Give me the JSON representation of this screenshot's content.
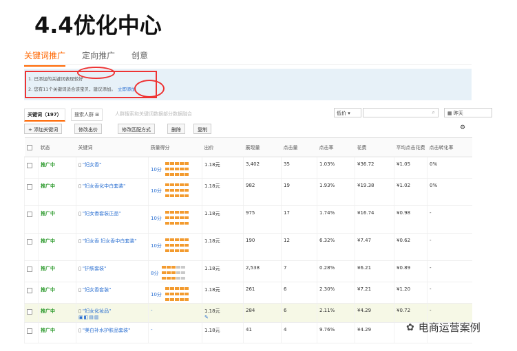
{
  "slide_title": "4.4优化中心",
  "tabs": [
    "关键词推广",
    "定向推广",
    "创意"
  ],
  "notice": {
    "line1": "1. 已添加的关键词表现较好",
    "line2": "2. 您有11个关键词适合该宝贝，建议添加。",
    "link": "立即添加"
  },
  "subbar": {
    "tab_keywords": "关键词（197）",
    "tab_people": "搜索人群",
    "hint": "人群搜索和关键词数据部分数据融合",
    "select": "低价",
    "date": "昨天"
  },
  "toolbar": {
    "add": "+ 添加关键词",
    "bid": "修改出价",
    "match": "修改匹配方式",
    "delete": "删除",
    "copy": "复制",
    "settings_icon": "gear-icon"
  },
  "columns": [
    "状态",
    "关键词",
    "质量得分",
    "出价",
    "展现量",
    "点击量",
    "点击率",
    "花费",
    "平均点击花费",
    "点击转化率"
  ],
  "rows": [
    {
      "status": "推广中",
      "keyword": "\"妇女香\"",
      "score": "10分",
      "bid": "1.18元",
      "impr": "3,402",
      "clicks": "35",
      "ctr": "1.03%",
      "cost": "¥36.72",
      "cpc": "¥1.05",
      "cvr": "0%"
    },
    {
      "status": "推广中",
      "keyword": "\"妇女香化中白套装\"",
      "score": "10分",
      "bid": "1.18元",
      "impr": "982",
      "clicks": "19",
      "ctr": "1.93%",
      "cost": "¥19.38",
      "cpc": "¥1.02",
      "cvr": "0%"
    },
    {
      "status": "推广中",
      "keyword": "\"妇女香套装正品\"",
      "score": "10分",
      "bid": "1.18元",
      "impr": "975",
      "clicks": "17",
      "ctr": "1.74%",
      "cost": "¥16.74",
      "cpc": "¥0.98",
      "cvr": "-"
    },
    {
      "status": "推广中",
      "keyword": "\"妇女香 妇女香中白套装\"",
      "score": "10分",
      "bid": "1.18元",
      "impr": "190",
      "clicks": "12",
      "ctr": "6.32%",
      "cost": "¥7.47",
      "cpc": "¥0.62",
      "cvr": "-"
    },
    {
      "status": "推广中",
      "keyword": "\"护肤套装\"",
      "score": "8分",
      "bid": "1.18元",
      "impr": "2,538",
      "clicks": "7",
      "ctr": "0.28%",
      "cost": "¥6.21",
      "cpc": "¥0.89",
      "cvr": "-"
    },
    {
      "status": "推广中",
      "keyword": "\"妇女香套装\"",
      "score": "10分",
      "bid": "1.18元",
      "impr": "261",
      "clicks": "6",
      "ctr": "2.30%",
      "cost": "¥7.21",
      "cpc": "¥1.20",
      "cvr": "-"
    },
    {
      "status": "推广中",
      "keyword": "\"妇女化妆品\"",
      "score": "-",
      "bid": "1.18元",
      "impr": "284",
      "clicks": "6",
      "ctr": "2.11%",
      "cost": "¥4.29",
      "cpc": "¥0.72",
      "cvr": "-"
    },
    {
      "status": "推广中",
      "keyword": "\"美白补水护肤品套装\"",
      "score": "-",
      "bid": "1.18元",
      "impr": "41",
      "clicks": "4",
      "ctr": "9.76%",
      "cost": "¥4.29",
      "cpc": "",
      "cvr": ""
    }
  ],
  "watermark": "电商运营案例",
  "colors": {
    "accent": "#ff6600",
    "status_green": "#2d9a2d",
    "link_blue": "#2a6fd1",
    "annotation_red": "#ee3333"
  }
}
